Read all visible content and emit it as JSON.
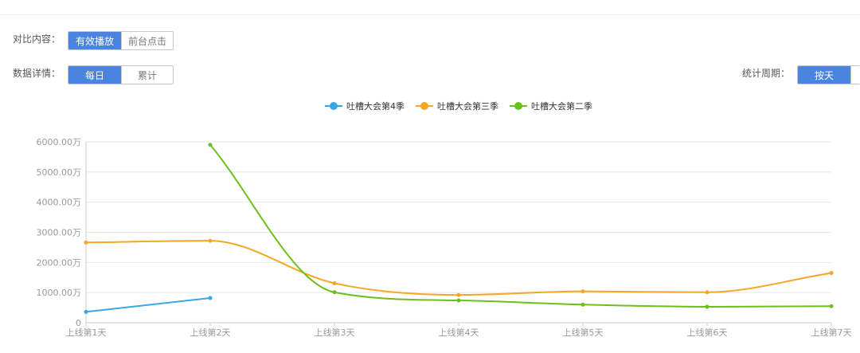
{
  "compare": {
    "label": "对比内容：",
    "options": [
      "有效播放",
      "前台点击"
    ],
    "active": 0
  },
  "detail": {
    "label": "数据详情：",
    "options": [
      "每日",
      "累计"
    ],
    "active": 0
  },
  "period": {
    "label": "统计周期：",
    "options": [
      "按天"
    ],
    "active": 0
  },
  "colors": {
    "accent": "#4a84e0",
    "s4": "#3aa6e8",
    "s3": "#f5a623",
    "s2": "#6cc01c"
  },
  "chart_data": {
    "type": "line",
    "categories": [
      "上线第1天",
      "上线第2天",
      "上线第3天",
      "上线第4天",
      "上线第5天",
      "上线第6天",
      "上线第7天"
    ],
    "ylim": [
      0,
      6000
    ],
    "yticks": [
      0,
      1000,
      2000,
      3000,
      4000,
      5000,
      6000
    ],
    "ytick_labels": [
      "0",
      "1000.00万",
      "2000.00万",
      "3000.00万",
      "4000.00万",
      "5000.00万",
      "6000.00万"
    ],
    "legend_position": "top-center",
    "grid": true,
    "series": [
      {
        "name": "吐槽大会第4季",
        "color": "#3aa6e8",
        "values": [
          360,
          820,
          null,
          null,
          null,
          null,
          null
        ]
      },
      {
        "name": "吐槽大会第三季",
        "color": "#f5a623",
        "values": [
          2660,
          2720,
          1310,
          920,
          1040,
          1010,
          1650
        ]
      },
      {
        "name": "吐槽大会第二季",
        "color": "#6cc01c",
        "values": [
          null,
          5900,
          1010,
          740,
          600,
          530,
          550
        ]
      }
    ]
  }
}
